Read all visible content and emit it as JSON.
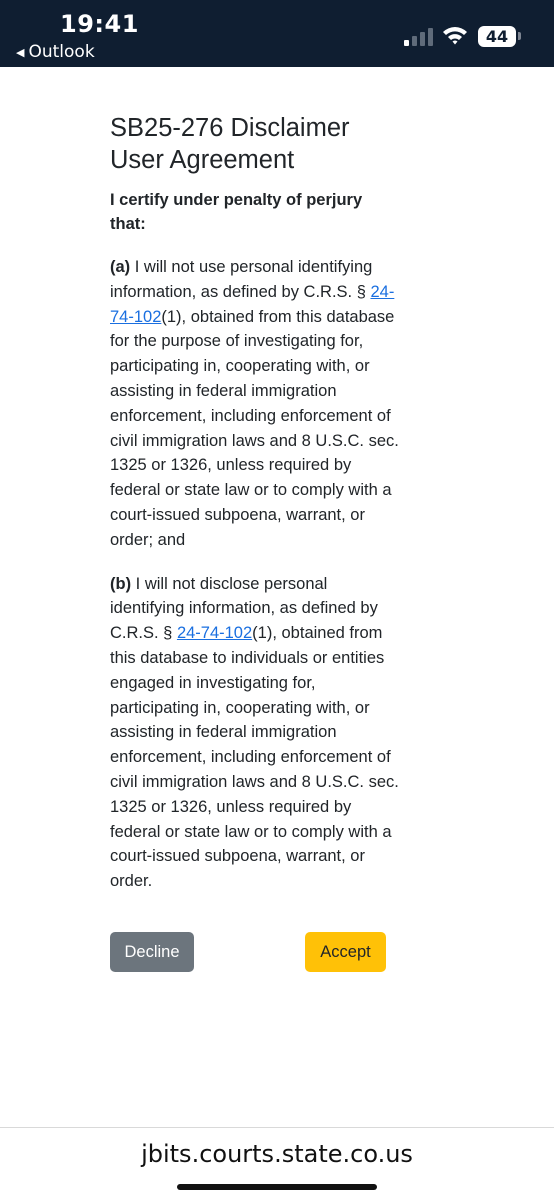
{
  "status_bar": {
    "time": "19:41",
    "back_app": "Outlook",
    "battery": "44"
  },
  "agreement": {
    "title": "SB25-276 Disclaimer User Agreement",
    "lead": "I certify under penalty of perjury that:",
    "clause_a": {
      "marker": "(a)",
      "text_before_link": " I will not use personal identifying information, as defined by C.R.S. § ",
      "link": "24-74-102",
      "text_after_link": "(1), obtained from this database for the purpose of investigating for, participating in, cooperating with, or assisting in federal immigration enforcement, including enforcement of civil immigration laws and 8 U.S.C. sec. 1325 or 1326, unless required by federal or state law or to comply with a court-issued subpoena, warrant, or order; and"
    },
    "clause_b": {
      "marker": "(b)",
      "text_before_link": " I will not disclose personal identifying information, as defined by C.R.S. § ",
      "link": "24-74-102",
      "text_after_link": "(1), obtained from this database to individuals or entities engaged in investigating for, participating in, cooperating with, or assisting in federal immigration enforcement, including enforcement of civil immigration laws and 8 U.S.C. sec. 1325 or 1326, unless required by federal or state law or to comply with a court-issued subpoena, warrant, or order."
    },
    "decline_label": "Decline",
    "accept_label": "Accept"
  },
  "browser": {
    "url": "jbits.courts.state.co.us"
  },
  "colors": {
    "status_bar_bg": "#0f1e31",
    "link": "#1a6fe0",
    "decline": "#6c757d",
    "accept": "#ffc107"
  }
}
